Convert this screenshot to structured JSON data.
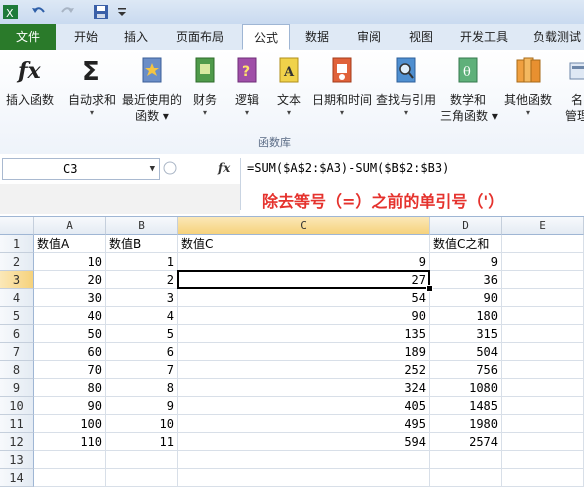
{
  "ribbon_tabs": [
    "文件",
    "开始",
    "插入",
    "页面布局",
    "公式",
    "数据",
    "审阅",
    "视图",
    "开发工具",
    "负载测试"
  ],
  "ribbon_buttons": [
    {
      "label": "插入函数",
      "label2": "",
      "arrow": false,
      "icon": "fx-icon"
    },
    {
      "label": "自动求和",
      "label2": "",
      "arrow": true,
      "icon": "sigma-icon"
    },
    {
      "label": "最近使用的",
      "label2": "函数",
      "arrow": true,
      "icon": "star-book-icon"
    },
    {
      "label": "财务",
      "label2": "",
      "arrow": true,
      "icon": "finance-book-icon"
    },
    {
      "label": "逻辑",
      "label2": "",
      "arrow": true,
      "icon": "logic-book-icon"
    },
    {
      "label": "文本",
      "label2": "",
      "arrow": true,
      "icon": "text-book-icon"
    },
    {
      "label": "日期和时间",
      "label2": "",
      "arrow": true,
      "icon": "datetime-book-icon"
    },
    {
      "label": "查找与引用",
      "label2": "",
      "arrow": true,
      "icon": "lookup-book-icon"
    },
    {
      "label": "数学和",
      "label2": "三角函数",
      "arrow": true,
      "icon": "math-book-icon"
    },
    {
      "label": "其他函数",
      "label2": "",
      "arrow": true,
      "icon": "more-book-icon"
    },
    {
      "label": "名",
      "label2": "管理",
      "arrow": false,
      "icon": "name-manager-icon"
    }
  ],
  "group_label": "函数库",
  "name_box": "C3",
  "formula": "=SUM($A$2:$A3)-SUM($B$2:$B3)",
  "annotation": "除去等号（=）之前的单引号（'）",
  "columns": [
    "A",
    "B",
    "C",
    "D",
    "E"
  ],
  "rows": [
    [
      "数值A",
      "数值B",
      "数值C",
      "数值C之和"
    ],
    [
      "10",
      "1",
      "9",
      "9"
    ],
    [
      "20",
      "2",
      "27",
      "36"
    ],
    [
      "30",
      "3",
      "54",
      "90"
    ],
    [
      "40",
      "4",
      "90",
      "180"
    ],
    [
      "50",
      "5",
      "135",
      "315"
    ],
    [
      "60",
      "6",
      "189",
      "504"
    ],
    [
      "70",
      "7",
      "252",
      "756"
    ],
    [
      "80",
      "8",
      "324",
      "1080"
    ],
    [
      "90",
      "9",
      "405",
      "1485"
    ],
    [
      "100",
      "10",
      "495",
      "1980"
    ],
    [
      "110",
      "11",
      "594",
      "2574"
    ],
    [
      "",
      "",
      "",
      ""
    ],
    [
      "",
      "",
      "",
      ""
    ]
  ],
  "colors": {
    "file_tab": "#2a7a2a",
    "annotation": "#e5322d",
    "selection_header": "#f6d27c"
  }
}
